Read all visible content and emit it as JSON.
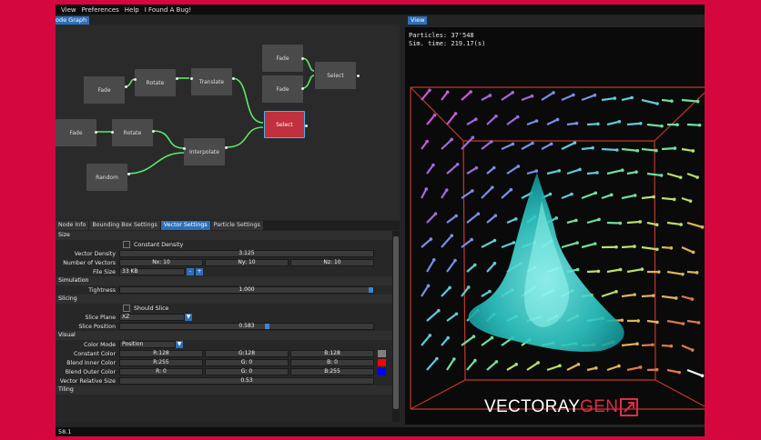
{
  "menu": [
    "View",
    "Preferences",
    "Help",
    "I Found A Bug!"
  ],
  "graph": {
    "tab": "ode Graph",
    "nodes": [
      {
        "id": "fade1",
        "label": "Fade"
      },
      {
        "id": "rotate1",
        "label": "Rotate"
      },
      {
        "id": "translate",
        "label": "Translate"
      },
      {
        "id": "fade2",
        "label": "Fade"
      },
      {
        "id": "rotate2",
        "label": "Rotate"
      },
      {
        "id": "interpolate",
        "label": "Interpolate"
      },
      {
        "id": "random",
        "label": "Random"
      },
      {
        "id": "fade3",
        "label": "Fade"
      },
      {
        "id": "fade4",
        "label": "Fade"
      },
      {
        "id": "select1",
        "label": "Select"
      },
      {
        "id": "select2",
        "label": "Select"
      }
    ]
  },
  "tabs": [
    "Node Info",
    "Bounding Box Settings",
    "Vector Settings",
    "Particle Settings"
  ],
  "active_tab": "Vector Settings",
  "props": {
    "size": {
      "title": "Size",
      "constant_density": "Constant Density",
      "vector_density_label": "Vector Density",
      "vector_density": "3.125",
      "number_of_vectors_label": "Number of Vectors",
      "nx": "Nx: 10",
      "ny": "Ny: 10",
      "nz": "Nz: 10",
      "file_size_label": "File Size",
      "file_size": "33 KB",
      "minus": "-",
      "plus": "+"
    },
    "simulation": {
      "title": "Simulation",
      "tightness_label": "Tightness",
      "tightness": "1.000",
      "tightness_fraction": 1.0
    },
    "slicing": {
      "title": "Slicing",
      "should_slice": "Should Slice",
      "slice_plane_label": "Slice Plane",
      "slice_plane": "XZ",
      "slice_position_label": "Slice Position",
      "slice_position": "0.583",
      "slice_fraction": 0.583
    },
    "visual": {
      "title": "Visual",
      "color_mode_label": "Color Mode",
      "color_mode": "Position",
      "constant_color_label": "Constant Color",
      "constant_color": [
        "R:128",
        "G:128",
        "B:128"
      ],
      "constant_swatch": "#808080",
      "blend_inner_label": "Blend Inner Color",
      "blend_inner": [
        "R:255",
        "G:  0",
        "B:  0"
      ],
      "blend_inner_swatch": "#ff0000",
      "blend_outer_label": "Blend Outer Color",
      "blend_outer": [
        "R:  0",
        "G:  0",
        "B:255"
      ],
      "blend_outer_swatch": "#0000ff",
      "relative_size_label": "Vector Relative Size",
      "relative_size": "0.53"
    },
    "tiling": {
      "title": "Tiling"
    }
  },
  "status": "58.1",
  "view": {
    "tab": "View",
    "particles": "Particles: 37'548",
    "sim_time": "Sim. time: 219.17(s)",
    "brand_main": "VECTORAY",
    "brand_accent": "GEN"
  },
  "colors": {
    "accent": "#2e6fba",
    "selected_node": "#c0303f",
    "wire": "#5ee86a",
    "brand_red": "#e22a4a"
  }
}
